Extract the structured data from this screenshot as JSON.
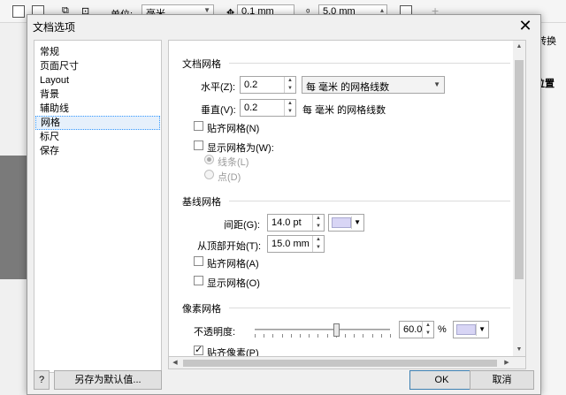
{
  "app": {
    "unit_label": "单位:",
    "unit_value": "毫米",
    "nudge_value": "0.1 mm",
    "dup_value": "5.0 mm",
    "right_snippets": {
      "tab": "转换",
      "pos": "位置"
    }
  },
  "dialog": {
    "title": "文档选项",
    "close_glyph": "✕",
    "nav": [
      "常规",
      "页面尺寸",
      "Layout",
      "背景",
      "辅助线",
      "网格",
      "标尺",
      "保存"
    ],
    "nav_selected": 5,
    "doc_grid": {
      "title": "文档网格",
      "horizontal_label": "水平(Z):",
      "horizontal_value": "0.2",
      "horizontal_mode": "每 毫米 的网格线数",
      "vertical_label": "垂直(V):",
      "vertical_value": "0.2",
      "vertical_unit": "每 毫米 的网格线数",
      "snap_label": "贴齐网格(N)",
      "show_as_label": "显示网格为(W):",
      "option_lines": "线条(L)",
      "option_dots": "点(D)"
    },
    "baseline_grid": {
      "title": "基线网格",
      "spacing_label": "间距(G):",
      "spacing_value": "14.0 pt",
      "start_label": "从顶部开始(T):",
      "start_value": "15.0 mm",
      "snap_label": "贴齐网格(A)",
      "show_label": "显示网格(O)",
      "color": "#d8d5f5"
    },
    "pixel_grid": {
      "title": "像素网格",
      "opacity_label": "不透明度:",
      "opacity_value": "60.0",
      "opacity_unit": "%",
      "opacity_level": 60,
      "snap_label": "贴齐像素(P)",
      "color": "#d8d5f5"
    },
    "buttons": {
      "help": "?",
      "save_default": "另存为默认值...",
      "ok": "OK",
      "cancel": "取消"
    }
  }
}
